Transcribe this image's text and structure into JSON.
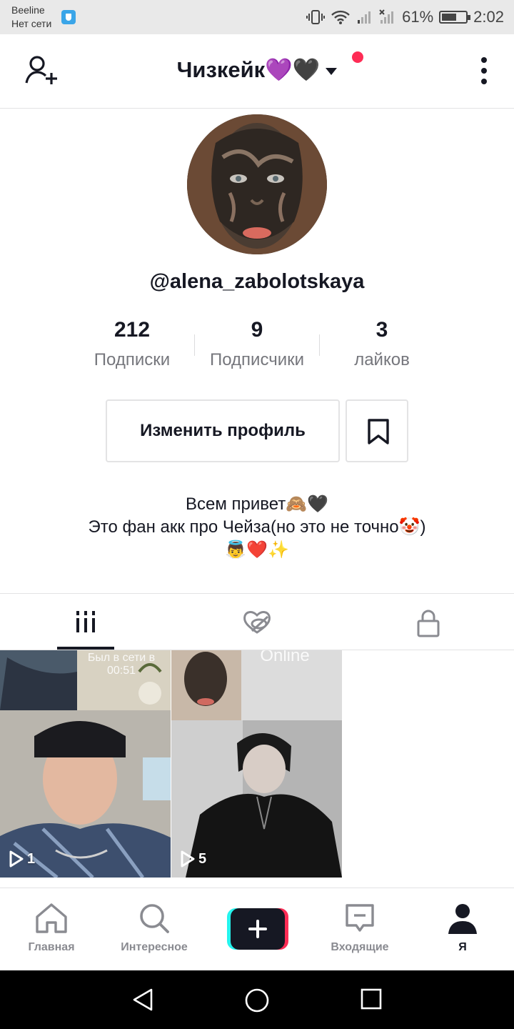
{
  "status_bar": {
    "carrier": "Beeline",
    "network": "Нет сети",
    "battery": "61%",
    "battery_level": 0.61,
    "time": "2:02"
  },
  "header": {
    "title": "Чизкейк💜🖤",
    "notification_dot_color": "#fe2c55"
  },
  "profile": {
    "username": "@alena_zabolotskaya",
    "stats": [
      {
        "value": "212",
        "label": "Подписки"
      },
      {
        "value": "9",
        "label": "Подписчики"
      },
      {
        "value": "3",
        "label": "лайков"
      }
    ],
    "edit_button": "Изменить профиль",
    "bio_lines": [
      "Всем привет🙈🖤",
      "Это фан акк про Чейза(но это не точно🤡)",
      "👼❤️✨"
    ]
  },
  "tabs": [
    {
      "icon": "grid-icon",
      "active": true
    },
    {
      "icon": "liked-hidden-icon",
      "active": false
    },
    {
      "icon": "lock-icon",
      "active": false
    }
  ],
  "videos": [
    {
      "plays": "1",
      "overlay": "Был в сети в\n00:51"
    },
    {
      "plays": "5",
      "overlay": "Online"
    }
  ],
  "bottom_nav": [
    {
      "label": "Главная",
      "icon": "home-icon"
    },
    {
      "label": "Интересное",
      "icon": "search-icon"
    },
    {
      "label": "",
      "icon": "create-plus-icon"
    },
    {
      "label": "Входящие",
      "icon": "inbox-icon"
    },
    {
      "label": "Я",
      "icon": "profile-icon",
      "active": true
    }
  ],
  "colors": {
    "text": "#161823",
    "secondary": "#75767c",
    "accent_red": "#fe2c55",
    "accent_cyan": "#25f4ee"
  }
}
